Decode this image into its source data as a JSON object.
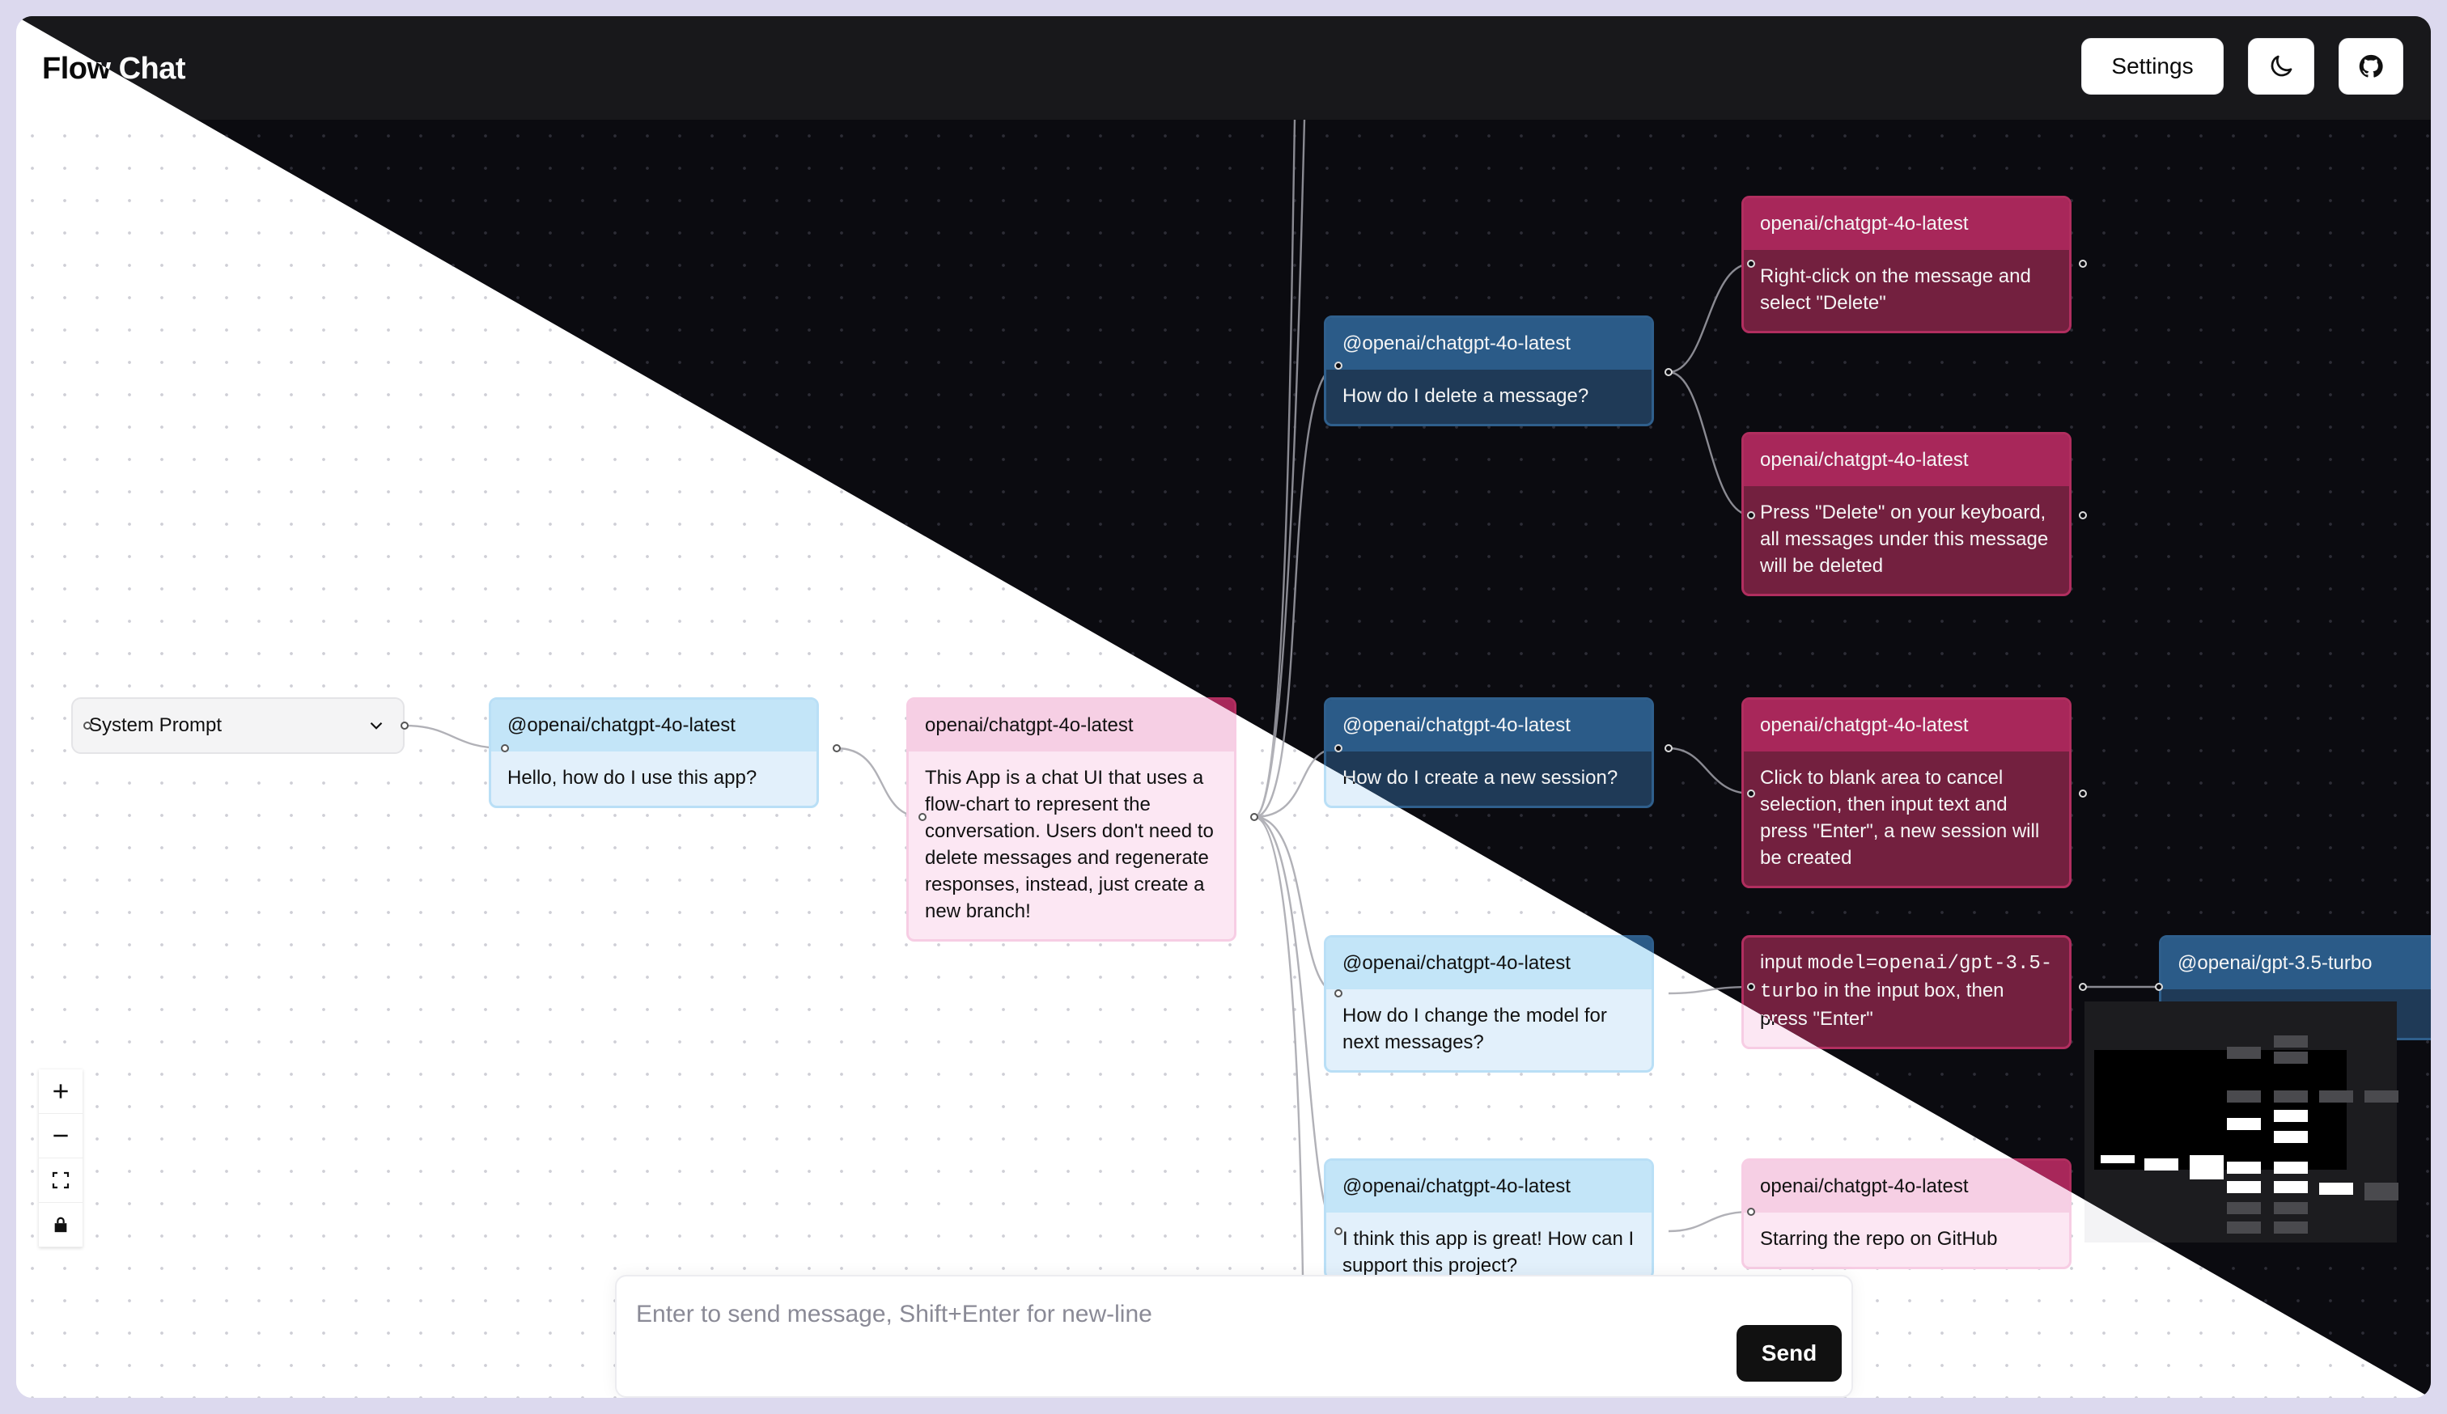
{
  "header": {
    "brand": "Flow Chat",
    "settings_label": "Settings",
    "theme_icon": "moon-icon",
    "github_icon": "github-icon"
  },
  "system_prompt": {
    "label": "System Prompt",
    "icon": "chevron-down-icon"
  },
  "nodes": {
    "q1": {
      "model": "@openai/chatgpt-4o-latest",
      "text": "Hello, how do I use this app?"
    },
    "a1": {
      "model": "openai/chatgpt-4o-latest",
      "text": "This App is a chat UI that uses a flow-chart to represent the conversation. Users don't need to delete messages and regenerate responses, instead, just create a new branch!"
    },
    "q_delete": {
      "model": "@openai/chatgpt-4o-latest",
      "text": "How do I delete a message?"
    },
    "a_delete_1": {
      "model": "openai/chatgpt-4o-latest",
      "text": "Right-click on the message and select \"Delete\""
    },
    "a_delete_2": {
      "model": "openai/chatgpt-4o-latest",
      "text": "Press \"Delete\" on your keyboard, all messages under this message will be deleted"
    },
    "q_session": {
      "model": "@openai/chatgpt-4o-latest",
      "text": "How do I create a new session?"
    },
    "a_session": {
      "model": "openai/chatgpt-4o-latest",
      "text": "Click to blank area to cancel selection, then input text and press \"Enter\", a new session will be created"
    },
    "q_model": {
      "model": "@openai/chatgpt-4o-latest",
      "text": "How do I change the model for next messages?"
    },
    "a_model": {
      "model": "",
      "text_prefix": "input ",
      "code": "model=openai/gpt-3.5-turbo",
      "text_suffix": " in the input box, then press \"Enter\""
    },
    "q_gpt35": {
      "model": "@openai/gpt-3.5-turbo",
      "text": ""
    },
    "q_support": {
      "model": "@openai/chatgpt-4o-latest",
      "text": "I think this app is great! How can I support this project?"
    },
    "a_support": {
      "model": "openai/chatgpt-4o-latest",
      "text": "Starring the repo on GitHub"
    }
  },
  "controls": {
    "zoom_in_icon": "plus-icon",
    "zoom_out_icon": "minus-icon",
    "fit_icon": "fit-view-icon",
    "lock_icon": "lock-icon"
  },
  "composer": {
    "placeholder": "Enter to send message, Shift+Enter for new-line",
    "send_label": "Send"
  },
  "colors": {
    "user_light": "#c3e5f8",
    "bot_light": "#f6cfe4",
    "user_dark": "#2b5b88",
    "bot_dark": "#a8275a"
  }
}
